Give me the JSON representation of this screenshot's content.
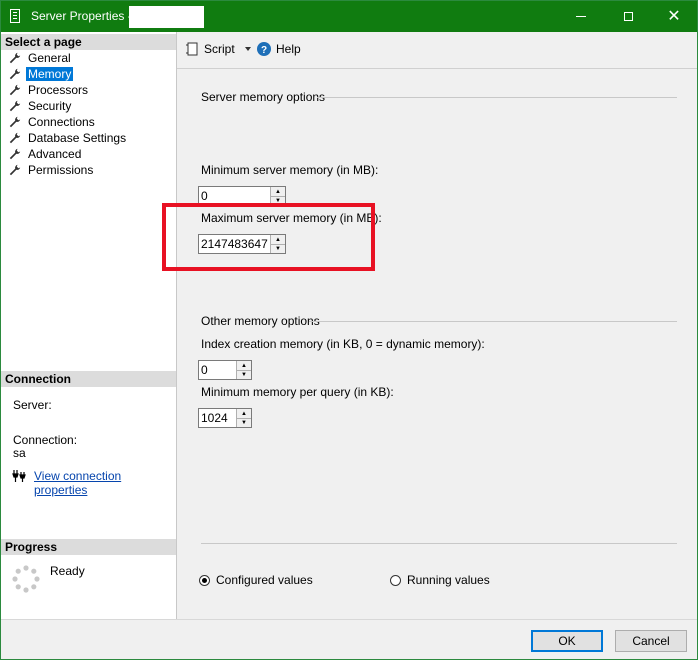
{
  "window": {
    "title": "Server Properties -",
    "minimize_icon": "minimize-icon",
    "maximize_icon": "maximize-icon",
    "close_glyph": "✕"
  },
  "select_page": {
    "header": "Select a page",
    "items": [
      {
        "label": "General",
        "selected": false
      },
      {
        "label": "Memory",
        "selected": true
      },
      {
        "label": "Processors",
        "selected": false
      },
      {
        "label": "Security",
        "selected": false
      },
      {
        "label": "Connections",
        "selected": false
      },
      {
        "label": "Database Settings",
        "selected": false
      },
      {
        "label": "Advanced",
        "selected": false
      },
      {
        "label": "Permissions",
        "selected": false
      }
    ]
  },
  "connection": {
    "header": "Connection",
    "server_label": "Server:",
    "connection_label": "Connection:",
    "connection_value": "sa",
    "view_link": "View connection properties"
  },
  "progress": {
    "header": "Progress",
    "status": "Ready"
  },
  "toolbar": {
    "script_label": "Script",
    "help_label": "Help"
  },
  "memory": {
    "server_memory_title": "Server memory options",
    "min_label": "Minimum server memory (in MB):",
    "min_value": "0",
    "max_label": "Maximum server memory (in MB):",
    "max_value": "2147483647",
    "other_title": "Other memory options",
    "index_label": "Index creation memory (in KB, 0 = dynamic memory):",
    "index_value": "0",
    "min_query_label": "Minimum memory per query (in KB):",
    "min_query_value": "1024"
  },
  "values_mode": {
    "configured_label": "Configured values",
    "running_label": "Running values",
    "selected": "configured"
  },
  "buttons": {
    "ok_label": "OK",
    "cancel_label": "Cancel"
  },
  "colors": {
    "titlebar": "#107c10",
    "selection": "#0078d7",
    "highlight": "#e81123",
    "link": "#0645ad"
  }
}
